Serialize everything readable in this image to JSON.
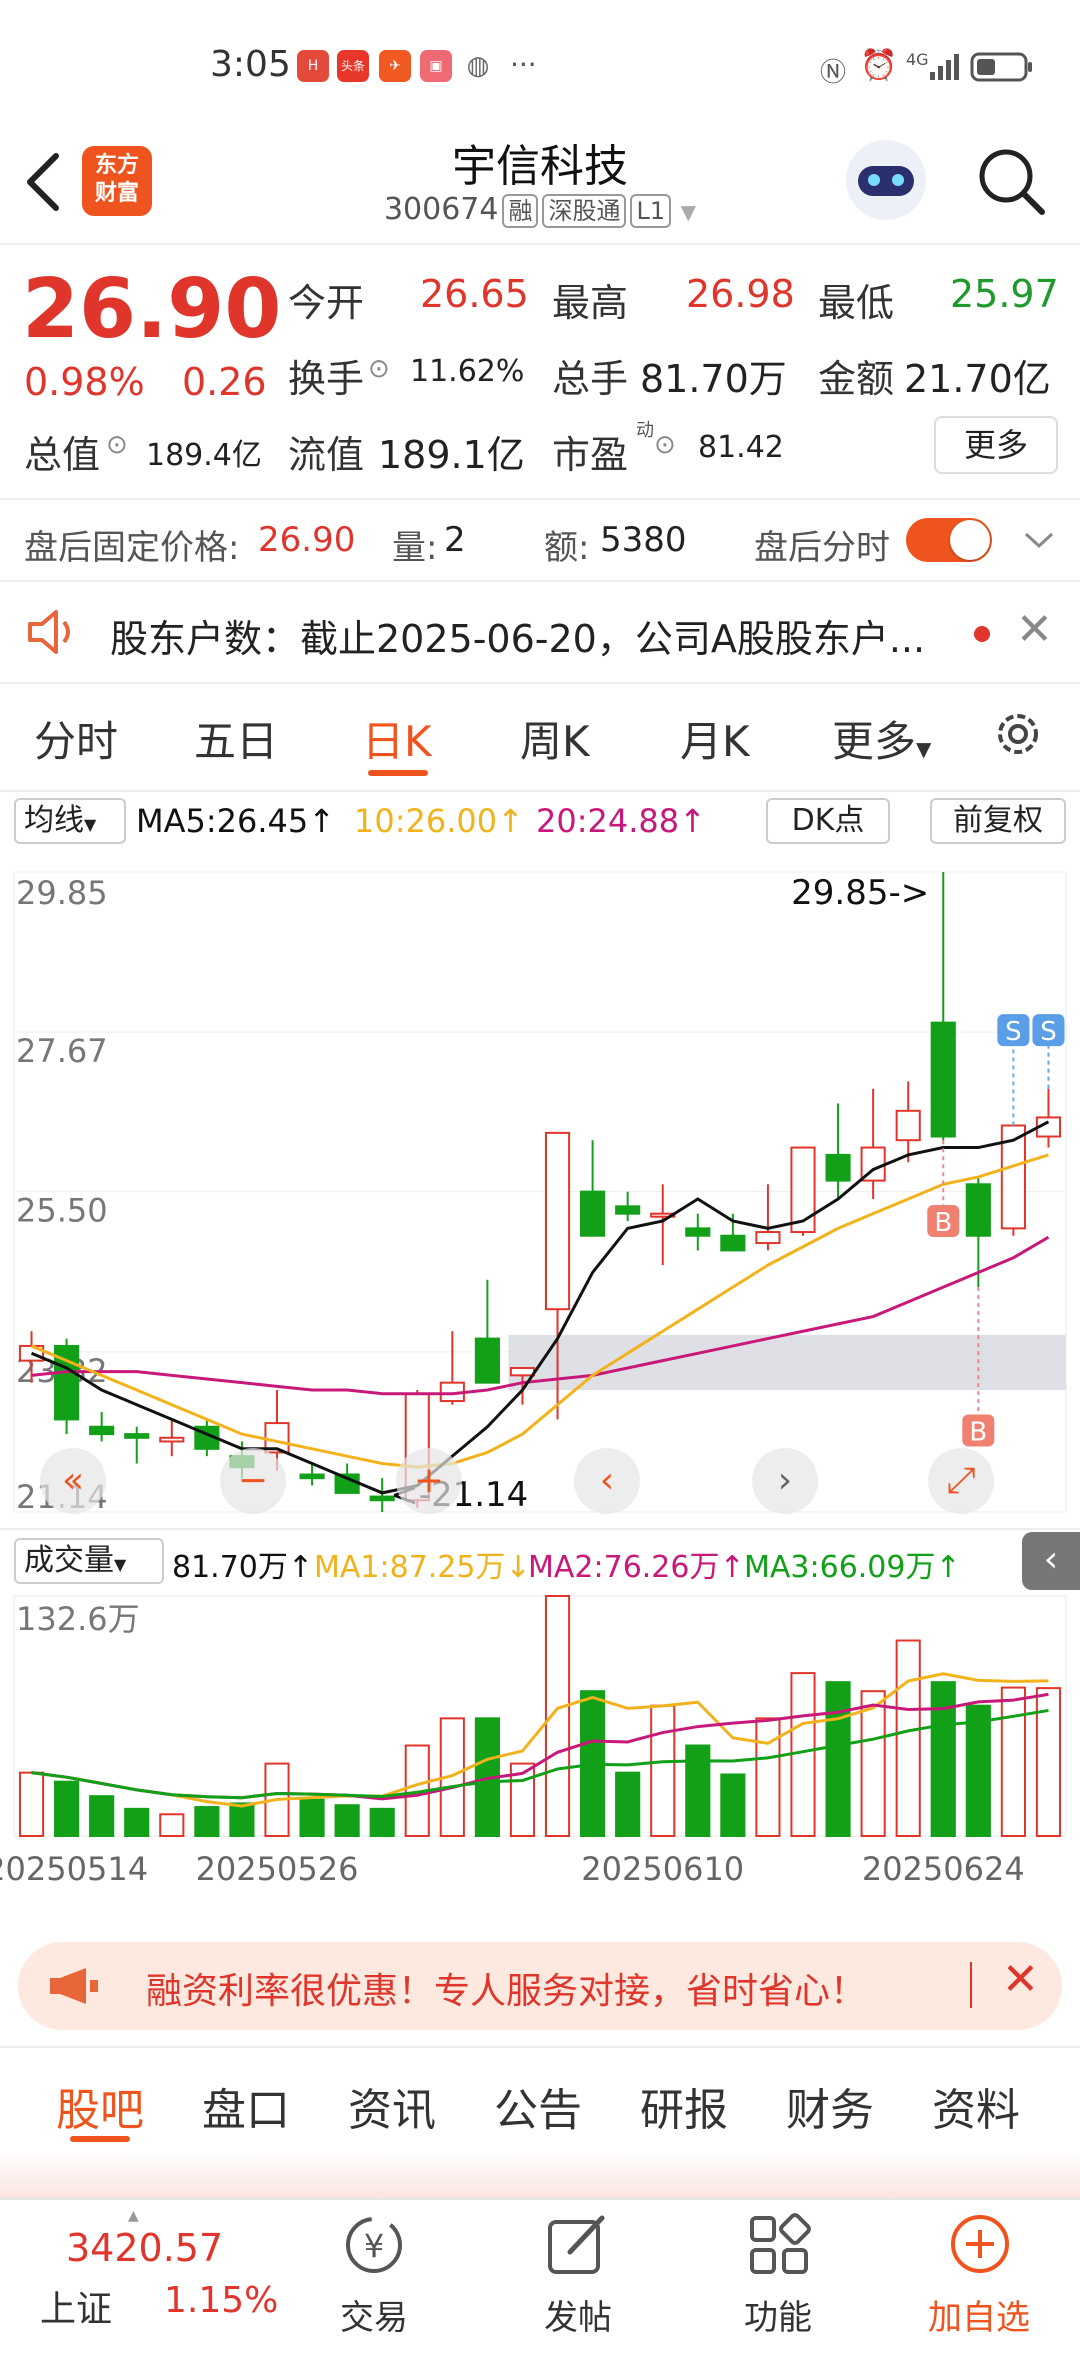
{
  "status": {
    "time": "3:05",
    "dots": "···",
    "net": "4G"
  },
  "header": {
    "logo_line1": "东方",
    "logo_line2": "财富",
    "title": "宇信科技",
    "code": "300674",
    "tag_rong": "融",
    "tag_sgt": "深股通",
    "tag_l1": "L1"
  },
  "quote": {
    "price": "26.90",
    "change_pct": "0.98%",
    "change_amt": "0.26",
    "open_label": "今开",
    "open": "26.65",
    "high_label": "最高",
    "high": "26.98",
    "low_label": "最低",
    "low": "25.97",
    "turnover_label": "换手",
    "turnover": "11.62%",
    "volume_label": "总手",
    "volume": "81.70万",
    "amount_label": "金额",
    "amount": "21.70亿",
    "mktcap_label": "总值",
    "mktcap": "189.4亿",
    "float_label": "流值",
    "float": "189.1亿",
    "pe_label": "市盈",
    "pe_sup": "动",
    "pe": "81.42",
    "more": "更多"
  },
  "afterhours": {
    "label": "盘后固定价格:",
    "price": "26.90",
    "qty_label": "量:",
    "qty": "2",
    "amt_label": "额:",
    "amt": "5380",
    "toggle_label": "盘后分时",
    "toggle_on": true
  },
  "notice": {
    "text": "股东户数：截止2025-06-20，公司A股股东户..."
  },
  "tabs": [
    "分时",
    "五日",
    "日K",
    "周K",
    "月K",
    "更多"
  ],
  "active_tab": 2,
  "ma_bar": {
    "selector": "均线",
    "ma5": "MA5:26.45↑",
    "ma10": "10:26.00↑",
    "ma20": "20:24.88↑",
    "dk": "DK点",
    "adj": "前复权"
  },
  "colors": {
    "up": "#e0352b",
    "down": "#12a018",
    "ma5": "#111111",
    "ma10": "#f2b21c",
    "ma20": "#c8197a",
    "accent": "#f0541e"
  },
  "vol_bar": {
    "selector": "成交量",
    "vol": "81.70万↑",
    "ma1": "MA1:87.25万↓",
    "ma2": "MA2:76.26万↑",
    "ma3": "MA3:66.09万↑"
  },
  "chart_data": {
    "type": "candlestick",
    "y_ticks": [
      "29.85",
      "27.67",
      "25.50",
      "23.32",
      "21.14"
    ],
    "ylim": [
      21.14,
      29.85
    ],
    "max_label": "29.85->",
    "min_label": "<-21.14",
    "vol_max_label": "132.6万",
    "vol_max": 132.6,
    "x_labels": [
      "20250514",
      "20250526",
      "20250610",
      "20250624"
    ],
    "signal_B": "B",
    "signal_S": "S",
    "candles": [
      {
        "o": 23.2,
        "h": 23.6,
        "l": 22.9,
        "c": 23.4,
        "v": 35
      },
      {
        "o": 23.4,
        "h": 23.5,
        "l": 22.2,
        "c": 22.4,
        "v": 30
      },
      {
        "o": 22.3,
        "h": 22.5,
        "l": 22.1,
        "c": 22.2,
        "v": 22
      },
      {
        "o": 22.2,
        "h": 22.3,
        "l": 21.8,
        "c": 22.15,
        "v": 15
      },
      {
        "o": 22.1,
        "h": 22.4,
        "l": 21.9,
        "c": 22.15,
        "v": 12
      },
      {
        "o": 22.3,
        "h": 22.4,
        "l": 21.9,
        "c": 22.0,
        "v": 16
      },
      {
        "o": 21.9,
        "h": 22.1,
        "l": 21.6,
        "c": 21.75,
        "v": 18
      },
      {
        "o": 21.95,
        "h": 22.8,
        "l": 21.7,
        "c": 22.35,
        "v": 40
      },
      {
        "o": 21.65,
        "h": 21.8,
        "l": 21.5,
        "c": 21.6,
        "v": 20
      },
      {
        "o": 21.65,
        "h": 21.8,
        "l": 21.4,
        "c": 21.4,
        "v": 17
      },
      {
        "o": 21.35,
        "h": 21.6,
        "l": 21.14,
        "c": 21.3,
        "v": 15
      },
      {
        "o": 21.3,
        "h": 22.8,
        "l": 21.2,
        "c": 22.75,
        "v": 50
      },
      {
        "o": 22.65,
        "h": 23.6,
        "l": 22.6,
        "c": 22.9,
        "v": 65
      },
      {
        "o": 23.5,
        "h": 24.3,
        "l": 23.0,
        "c": 22.9,
        "v": 65
      },
      {
        "o": 23.0,
        "h": 23.1,
        "l": 22.6,
        "c": 23.1,
        "v": 40
      },
      {
        "o": 23.9,
        "h": 24.3,
        "l": 22.4,
        "c": 26.3,
        "v": 132.6
      },
      {
        "o": 25.5,
        "h": 26.2,
        "l": 24.9,
        "c": 24.9,
        "v": 80
      },
      {
        "o": 25.3,
        "h": 25.5,
        "l": 25.1,
        "c": 25.2,
        "v": 35
      },
      {
        "o": 25.2,
        "h": 25.6,
        "l": 24.5,
        "c": 25.2,
        "v": 72
      },
      {
        "o": 25.0,
        "h": 25.2,
        "l": 24.7,
        "c": 24.9,
        "v": 50
      },
      {
        "o": 24.9,
        "h": 25.2,
        "l": 24.7,
        "c": 24.7,
        "v": 34
      },
      {
        "o": 24.8,
        "h": 25.6,
        "l": 24.7,
        "c": 24.95,
        "v": 65
      },
      {
        "o": 24.95,
        "h": 26.1,
        "l": 24.9,
        "c": 26.1,
        "v": 90
      },
      {
        "o": 26.0,
        "h": 26.7,
        "l": 25.4,
        "c": 25.65,
        "v": 85
      },
      {
        "o": 25.65,
        "h": 26.9,
        "l": 25.4,
        "c": 26.1,
        "v": 80
      },
      {
        "o": 26.2,
        "h": 27.0,
        "l": 25.9,
        "c": 26.6,
        "v": 108
      },
      {
        "o": 27.8,
        "h": 29.85,
        "l": 26.2,
        "c": 26.25,
        "v": 85
      },
      {
        "o": 25.6,
        "h": 25.7,
        "l": 24.2,
        "c": 24.9,
        "v": 72
      },
      {
        "o": 25.0,
        "h": 26.4,
        "l": 24.9,
        "c": 26.4,
        "v": 82
      },
      {
        "o": 26.25,
        "h": 26.9,
        "l": 26.1,
        "c": 26.51,
        "v": 81.7
      }
    ],
    "ma5": [
      23.3,
      23.1,
      22.8,
      22.6,
      22.4,
      22.2,
      22.0,
      22.0,
      21.8,
      21.6,
      21.4,
      21.5,
      21.9,
      22.3,
      22.8,
      23.5,
      24.4,
      25.0,
      25.1,
      25.4,
      25.1,
      25.0,
      25.1,
      25.4,
      25.8,
      26.0,
      26.1,
      26.1,
      26.2,
      26.45
    ],
    "ma10": [
      23.4,
      23.2,
      23.0,
      22.8,
      22.6,
      22.4,
      22.2,
      22.1,
      22.0,
      21.9,
      21.8,
      21.75,
      21.8,
      21.95,
      22.2,
      22.6,
      23.0,
      23.3,
      23.6,
      23.9,
      24.2,
      24.5,
      24.75,
      25.0,
      25.2,
      25.4,
      25.6,
      25.7,
      25.85,
      26.0
    ],
    "ma20": [
      23.0,
      23.05,
      23.05,
      23.05,
      23.0,
      22.95,
      22.9,
      22.85,
      22.8,
      22.8,
      22.75,
      22.75,
      22.75,
      22.8,
      22.9,
      22.95,
      23.0,
      23.1,
      23.2,
      23.3,
      23.4,
      23.5,
      23.6,
      23.7,
      23.8,
      24.0,
      24.2,
      24.4,
      24.6,
      24.88
    ]
  },
  "ad_banner": {
    "text": "融资利率很优惠！专人服务对接，省时省心！"
  },
  "bottom_tabs": [
    "股吧",
    "盘口",
    "资讯",
    "公告",
    "研报",
    "财务",
    "资料"
  ],
  "bottom_nav": {
    "index_value": "3420.57",
    "index_name": "上证",
    "index_change": "1.15%",
    "items": [
      "交易",
      "发帖",
      "功能",
      "加自选"
    ]
  }
}
